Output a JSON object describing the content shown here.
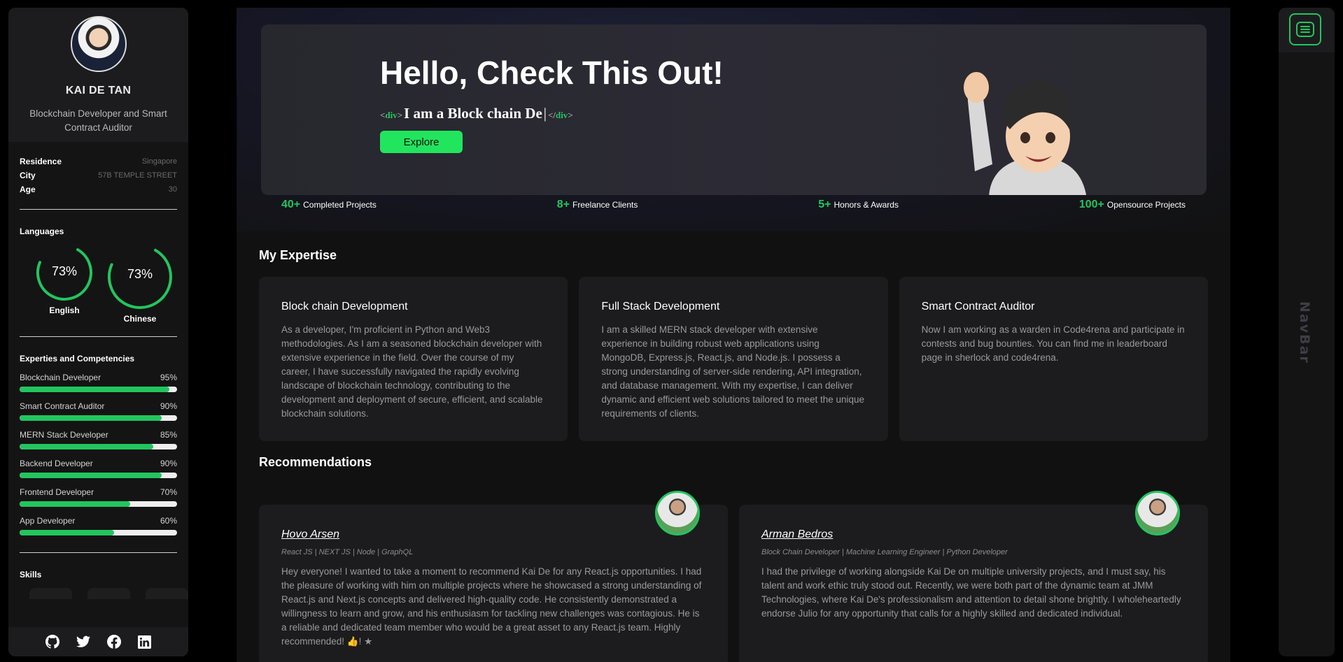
{
  "profile": {
    "name": "KAI DE TAN",
    "role": "Blockchain Developer and Smart Contract Auditor"
  },
  "info": [
    {
      "key": "Residence",
      "value": "Singapore"
    },
    {
      "key": "City",
      "value": "57B TEMPLE STREET"
    },
    {
      "key": "Age",
      "value": "30"
    }
  ],
  "languages": {
    "title": "Languages",
    "items": [
      {
        "label": "English",
        "percent": "73%"
      },
      {
        "label": "Chinese",
        "percent": "73%"
      }
    ]
  },
  "expertise_skills": {
    "title": "Experties and Competencies",
    "items": [
      {
        "label": "Blockchain Developer",
        "percent": "95%",
        "value": 95
      },
      {
        "label": "Smart Contract Auditor",
        "percent": "90%",
        "value": 90
      },
      {
        "label": "MERN Stack Developer",
        "percent": "85%",
        "value": 85
      },
      {
        "label": "Backend Developer",
        "percent": "90%",
        "value": 90
      },
      {
        "label": "Frontend Developer",
        "percent": "70%",
        "value": 70
      },
      {
        "label": "App Developer",
        "percent": "60%",
        "value": 60
      }
    ]
  },
  "skills": {
    "title": "Skills"
  },
  "social": [
    "github-icon",
    "twitter-icon",
    "facebook-icon",
    "linkedin-icon"
  ],
  "hero": {
    "title": "Hello, Check This Out!",
    "tag_open_bracket": "<",
    "tag_name": "div",
    "tag_close_bracket": ">",
    "tag_end_open": "</",
    "typed_text": "I am a Block chain De",
    "explore_label": "Explore"
  },
  "stats": [
    {
      "number": "40+",
      "label": "Completed Projects"
    },
    {
      "number": "8+",
      "label": "Freelance Clients"
    },
    {
      "number": "5+",
      "label": "Honors & Awards"
    },
    {
      "number": "100+",
      "label": "Opensource Projects"
    }
  ],
  "my_expertise": {
    "title": "My Expertise",
    "cards": [
      {
        "title": "Block chain Development",
        "text": "As a developer, I'm proficient in Python and Web3 methodologies. As I am a seasoned blockchain developer with extensive experience in the field. Over the course of my career, I have successfully navigated the rapidly evolving landscape of blockchain technology, contributing to the development and deployment of secure, efficient, and scalable blockchain solutions."
      },
      {
        "title": "Full Stack Development",
        "text": "I am a skilled MERN stack developer with extensive experience in building robust web applications using MongoDB, Express.js, React.js, and Node.js. I possess a strong understanding of server-side rendering, API integration, and database management. With my expertise, I can deliver dynamic and efficient web solutions tailored to meet the unique requirements of clients."
      },
      {
        "title": "Smart Contract Auditor",
        "text": "Now I am working as a warden in Code4rena and participate in contests and bug bounties. You can find me in leaderboard page in sherlock and code4rena."
      }
    ]
  },
  "recommendations": {
    "title": "Recommendations",
    "items": [
      {
        "name": "Hovo Arsen",
        "tags": "React JS | NEXT JS | Node | GraphQL",
        "text": "Hey everyone! I wanted to take a moment to recommend Kai De for any React.js opportunities. I had the pleasure of working with him on multiple projects where he showcased a strong understanding of React.js and Next.js concepts and delivered high-quality code. He consistently demonstrated a willingness to learn and grow, and his enthusiasm for tackling new challenges was contagious. He is a reliable and dedicated team member who would be a great asset to any React.js team. Highly recommended! 👍! ★"
      },
      {
        "name": "Arman Bedros",
        "tags": "Block Chain Developer | Machine Learning Engineer | Python Developer",
        "text": "I had the privilege of working alongside Kai De on multiple university projects, and I must say, his talent and work ethic truly stood out. Recently, we were both part of the dynamic team at JMM Technologies, where Kai De's professionalism and attention to detail shone brightly. I wholeheartedly endorse Julio for any opportunity that calls for a highly skilled and dedicated individual."
      }
    ]
  },
  "navbar": {
    "label": "NavBar"
  },
  "colors": {
    "accent": "#22c55e"
  }
}
